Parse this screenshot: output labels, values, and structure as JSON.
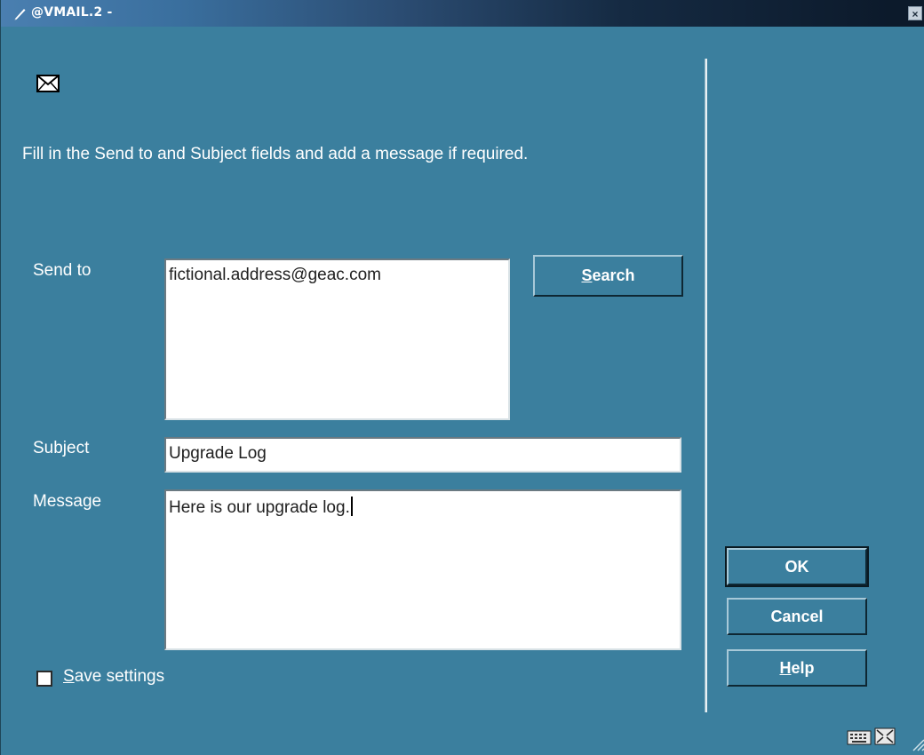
{
  "window": {
    "title": "@VMAIL.2 -",
    "close_label": "×"
  },
  "instructions": "Fill in the Send to and Subject fields and add a message if required.",
  "form": {
    "send_to_label": "Send to",
    "send_to_value": "fictional.address@geac.com",
    "search_label_accel": "S",
    "search_label_rest": "earch",
    "subject_label": "Subject",
    "subject_value": "Upgrade Log",
    "message_label": "Message",
    "message_value": "Here is our upgrade log."
  },
  "options": {
    "save_settings_accel": "S",
    "save_settings_rest": "ave settings",
    "save_settings_checked": false
  },
  "actions": {
    "ok_label": "OK",
    "cancel_label": "Cancel",
    "help_accel": "H",
    "help_rest": "elp"
  },
  "icons": {
    "title": "pen-icon",
    "mail": "envelope-icon",
    "status_keyboard": "keyboard-icon",
    "status_fullscreen": "fullscreen-icon",
    "resize": "resize-grip-icon"
  },
  "colors": {
    "background": "#3b7f9e",
    "text": "#ffffff"
  }
}
